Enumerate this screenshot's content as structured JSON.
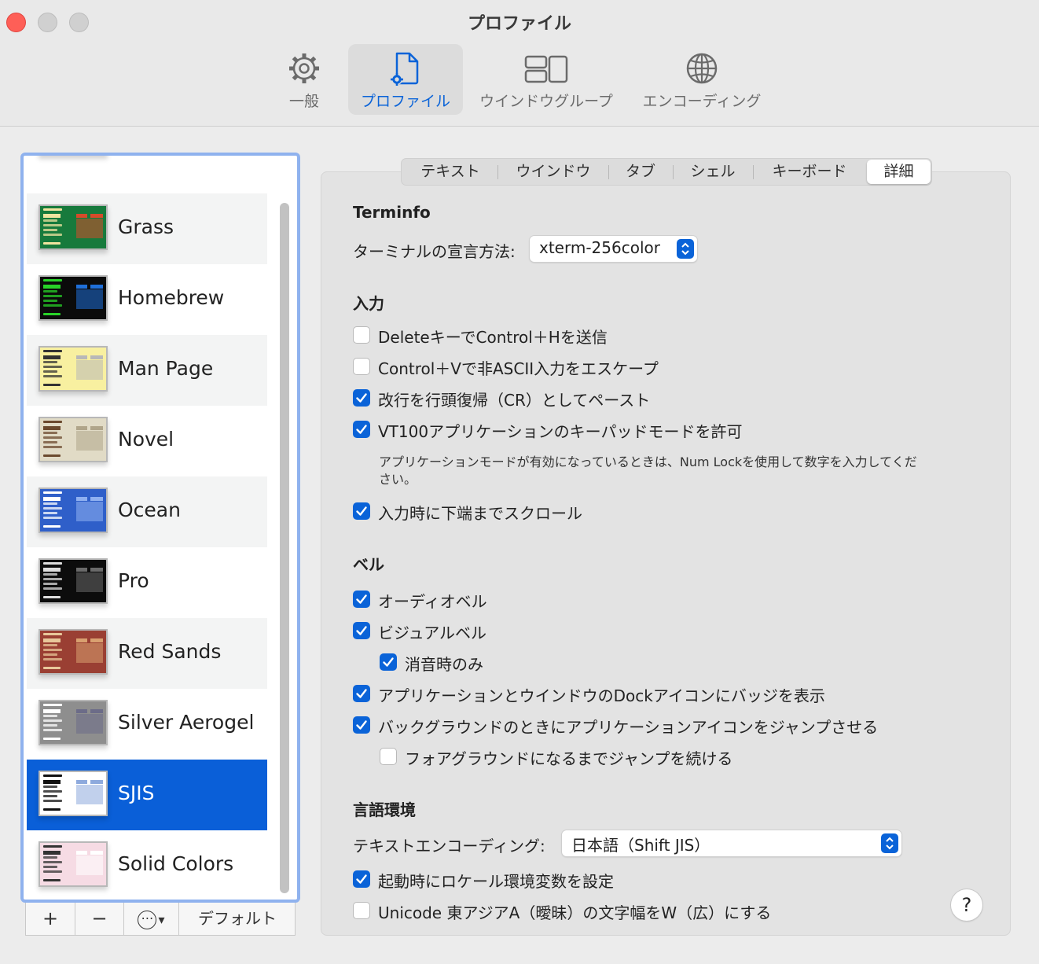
{
  "window": {
    "title": "プロファイル"
  },
  "toolbar": {
    "items": [
      {
        "label": "一般",
        "icon": "gear-icon"
      },
      {
        "label": "プロファイル",
        "icon": "profile-doc-icon"
      },
      {
        "label": "ウインドウグループ",
        "icon": "window-group-icon"
      },
      {
        "label": "エンコーディング",
        "icon": "globe-icon"
      }
    ]
  },
  "profiles": [
    {
      "name": "デフォルト",
      "bg": "#f4f4f4",
      "fg": "#555555",
      "accent": "#888888"
    },
    {
      "name": "Grass",
      "bg": "#177a3c",
      "fg": "#f0e4a0",
      "accent": "#d64b2a"
    },
    {
      "name": "Homebrew",
      "bg": "#0b0b0b",
      "fg": "#28d228",
      "accent": "#1f6fd8"
    },
    {
      "name": "Man Page",
      "bg": "#f8f0a0",
      "fg": "#333333",
      "accent": "#b8b8b8"
    },
    {
      "name": "Novel",
      "bg": "#e1dbc6",
      "fg": "#6b4a2e",
      "accent": "#b0a58a"
    },
    {
      "name": "Ocean",
      "bg": "#2f5fc9",
      "fg": "#ffffff",
      "accent": "#8fb0f0"
    },
    {
      "name": "Pro",
      "bg": "#0c0c0c",
      "fg": "#dddddd",
      "accent": "#6a6a6a"
    },
    {
      "name": "Red Sands",
      "bg": "#9a3f33",
      "fg": "#e8c79a",
      "accent": "#d9a070"
    },
    {
      "name": "Silver Aerogel",
      "bg": "#8e8e8e",
      "fg": "#ffffff",
      "accent": "#6c6c88"
    },
    {
      "name": "SJIS",
      "bg": "#ffffff",
      "fg": "#111111",
      "accent": "#8eaadd"
    },
    {
      "name": "Solid Colors",
      "bg": "#f6dbe4",
      "fg": "#333333",
      "accent": "#ffffff"
    }
  ],
  "selected_profile": "SJIS",
  "list_buttons": {
    "add": "+",
    "remove": "−",
    "more": "⋯",
    "chevron": "▾",
    "default": "デフォルト"
  },
  "tabs": [
    {
      "label": "テキスト"
    },
    {
      "label": "ウインドウ"
    },
    {
      "label": "タブ"
    },
    {
      "label": "シェル"
    },
    {
      "label": "キーボード"
    },
    {
      "label": "詳細"
    }
  ],
  "terminfo": {
    "title": "Terminfo",
    "declare_label": "ターミナルの宣言方法:",
    "declare_value": "xterm-256color"
  },
  "input": {
    "title": "入力",
    "delete_sends_ctrl_h": {
      "label": "DeleteキーでControl＋Hを送信",
      "checked": false
    },
    "escape_non_ascii": {
      "label": "Control＋Vで非ASCII入力をエスケープ",
      "checked": false
    },
    "paste_newline_cr": {
      "label": "改行を行頭復帰（CR）としてペースト",
      "checked": true
    },
    "vt100_keypad": {
      "label": "VT100アプリケーションのキーパッドモードを許可",
      "checked": true
    },
    "keypad_note": "アプリケーションモードが有効になっているときは、Num Lockを使用して数字を入力してください。",
    "scroll_to_bottom": {
      "label": "入力時に下端までスクロール",
      "checked": true
    }
  },
  "bell": {
    "title": "ベル",
    "audio_bell": {
      "label": "オーディオベル",
      "checked": true
    },
    "visual_bell": {
      "label": "ビジュアルベル",
      "checked": true
    },
    "only_when_muted": {
      "label": "消音時のみ",
      "checked": true
    },
    "dock_badge": {
      "label": "アプリケーションとウインドウのDockアイコンにバッジを表示",
      "checked": true
    },
    "bounce_icon": {
      "label": "バックグラウンドのときにアプリケーションアイコンをジャンプさせる",
      "checked": true
    },
    "bounce_until_foreground": {
      "label": "フォアグラウンドになるまでジャンプを続ける",
      "checked": false
    }
  },
  "locale": {
    "title": "言語環境",
    "encoding_label": "テキストエンコーディング:",
    "encoding_value": "日本語（Shift JIS）",
    "set_locale_vars": {
      "label": "起動時にロケール環境変数を設定",
      "checked": true
    },
    "unicode_east_asian": {
      "label": "Unicode 東アジアA（曖昧）の文字幅をW（広）にする",
      "checked": false
    }
  },
  "help": {
    "label": "?"
  }
}
